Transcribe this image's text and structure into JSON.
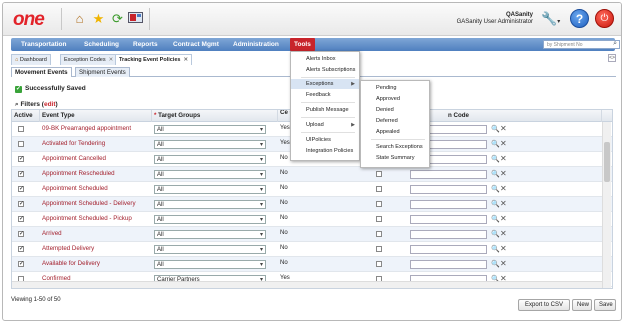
{
  "header": {
    "logo": "one",
    "user_name": "QASanity",
    "user_role": "GASanity User Administrator"
  },
  "nav": {
    "items": [
      "Transportation",
      "Scheduling",
      "Reports",
      "Contract Mgmt",
      "Administration",
      "Tools"
    ],
    "search_placeholder": "by Shipment No"
  },
  "page_tabs": [
    "Dashboard",
    "Exception Codes",
    "Tracking Event Policies"
  ],
  "sub_tabs": [
    "Movement Events",
    "Shipment Events"
  ],
  "success_message": "Successfully Saved",
  "filters": {
    "label": "Filters",
    "edit": "edit"
  },
  "table": {
    "headers": [
      "Active",
      "Event Type",
      "Target Groups",
      "Ce Co",
      "n Code"
    ],
    "rows": [
      {
        "active": false,
        "event": "09-BK Prearranged appointment",
        "group": "All",
        "cons": "Yes"
      },
      {
        "active": false,
        "event": "Activated for Tendering",
        "group": "All",
        "cons": "Yes"
      },
      {
        "active": true,
        "event": "Appointment Cancelled",
        "group": "All",
        "cons": "No"
      },
      {
        "active": true,
        "event": "Appointment Rescheduled",
        "group": "All",
        "cons": "No"
      },
      {
        "active": true,
        "event": "Appointment Scheduled",
        "group": "All",
        "cons": "No"
      },
      {
        "active": true,
        "event": "Appointment Scheduled - Delivery",
        "group": "All",
        "cons": "No"
      },
      {
        "active": true,
        "event": "Appointment Scheduled - Pickup",
        "group": "All",
        "cons": "No"
      },
      {
        "active": true,
        "event": "Arrived",
        "group": "All",
        "cons": "No"
      },
      {
        "active": true,
        "event": "Attempted Delivery",
        "group": "All",
        "cons": "No"
      },
      {
        "active": true,
        "event": "Available for Delivery",
        "group": "All",
        "cons": "No"
      },
      {
        "active": false,
        "event": "Confirmed",
        "group": "Carrier Partners",
        "cons": "Yes"
      }
    ]
  },
  "tools_menu": [
    "Alerts Inbox",
    "Alerts Subscriptions",
    "Exceptions",
    "Feedback",
    "Publish Message",
    "Upload",
    "UIPolicies",
    "Integration Policies"
  ],
  "exceptions_submenu": [
    "Pending",
    "Approved",
    "Denied",
    "Deferred",
    "Appealed",
    "Search Exceptions",
    "State Summary"
  ],
  "footer": {
    "viewing": "Viewing 1-50 of 50",
    "export": "Export to CSV",
    "new": "New",
    "save": "Save"
  },
  "colors": {
    "accent": "#c8242b",
    "nav": "#5c89c6"
  }
}
